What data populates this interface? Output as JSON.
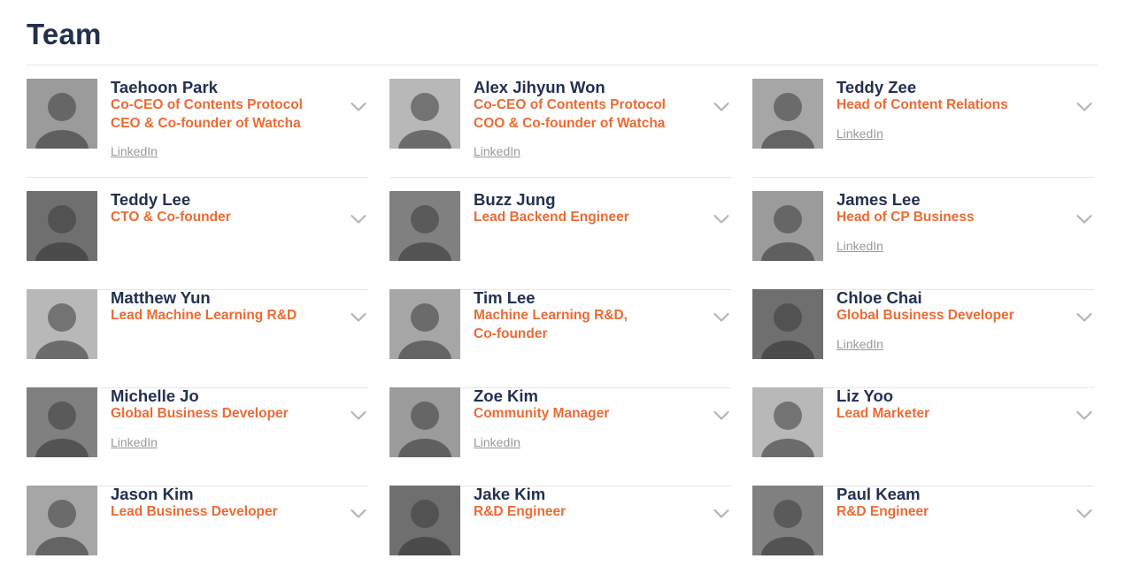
{
  "page": {
    "title": "Team"
  },
  "members": [
    {
      "name": "Taehoon Park",
      "roles": [
        "Co-CEO of Contents Protocol",
        "CEO & Co-founder of Watcha"
      ],
      "linkedin": "LinkedIn"
    },
    {
      "name": "Alex Jihyun Won",
      "roles": [
        "Co-CEO of Contents Protocol",
        "COO & Co-founder of Watcha"
      ],
      "linkedin": "LinkedIn"
    },
    {
      "name": "Teddy Zee",
      "roles": [
        "Head of Content Relations"
      ],
      "linkedin": "LinkedIn"
    },
    {
      "name": "Teddy Lee",
      "roles": [
        "CTO & Co-founder"
      ],
      "linkedin": ""
    },
    {
      "name": "Buzz Jung",
      "roles": [
        "Lead Backend Engineer"
      ],
      "linkedin": ""
    },
    {
      "name": "James Lee",
      "roles": [
        "Head of CP Business"
      ],
      "linkedin": "LinkedIn"
    },
    {
      "name": "Matthew Yun",
      "roles": [
        "Lead Machine Learning R&D"
      ],
      "linkedin": ""
    },
    {
      "name": "Tim Lee",
      "roles": [
        "Machine Learning R&D,",
        "Co-founder"
      ],
      "linkedin": ""
    },
    {
      "name": "Chloe Chai",
      "roles": [
        "Global Business Developer"
      ],
      "linkedin": "LinkedIn"
    },
    {
      "name": "Michelle Jo",
      "roles": [
        "Global Business Developer"
      ],
      "linkedin": "LinkedIn"
    },
    {
      "name": "Zoe Kim",
      "roles": [
        "Community Manager"
      ],
      "linkedin": "LinkedIn"
    },
    {
      "name": "Liz Yoo",
      "roles": [
        "Lead Marketer"
      ],
      "linkedin": ""
    },
    {
      "name": "Jason Kim",
      "roles": [
        "Lead Business Developer"
      ],
      "linkedin": ""
    },
    {
      "name": "Jake Kim",
      "roles": [
        "R&D Engineer"
      ],
      "linkedin": ""
    },
    {
      "name": "Paul Keam",
      "roles": [
        "R&D Engineer"
      ],
      "linkedin": ""
    }
  ],
  "colors": {
    "name": "#23304f",
    "role": "#ec6b35",
    "link": "#9a9a9a",
    "chevron": "#b5b5b5"
  },
  "icons": {
    "expand": "chevron-down-icon",
    "photo": "avatar"
  }
}
